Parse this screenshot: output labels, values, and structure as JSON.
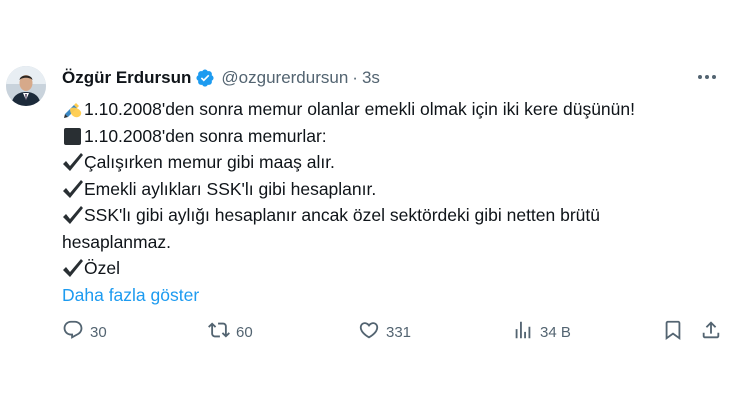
{
  "author": {
    "display_name": "Özgür Erdursun",
    "handle": "@ozgurerdursun",
    "separator": "·",
    "time": "3s"
  },
  "tweet": {
    "lines": [
      {
        "emoji": "writing-hand-icon",
        "text": "1.10.2008'den sonra memur olanlar emekli olmak için iki kere düşünün!"
      },
      {
        "emoji": "black-square-icon",
        "text": "1.10.2008'den sonra memurlar:"
      },
      {
        "emoji": "check-mark-icon",
        "text": "Çalışırken memur gibi maaş alır."
      },
      {
        "emoji": "check-mark-icon",
        "text": "Emekli aylıkları SSK'lı gibi hesaplanır."
      },
      {
        "emoji": "check-mark-icon",
        "text": "SSK'lı gibi aylığı hesaplanır ancak özel sektördeki gibi netten brütü"
      },
      {
        "emoji": "",
        "text": "hesaplanmaz."
      },
      {
        "emoji": "check-mark-icon",
        "text": "Özel"
      }
    ],
    "show_more": "Daha fazla göster"
  },
  "actions": {
    "replies": "30",
    "retweets": "60",
    "likes": "331",
    "views": "34 B"
  },
  "colors": {
    "link": "#1d9bf0",
    "secondary": "#536471",
    "text": "#0f1419"
  }
}
